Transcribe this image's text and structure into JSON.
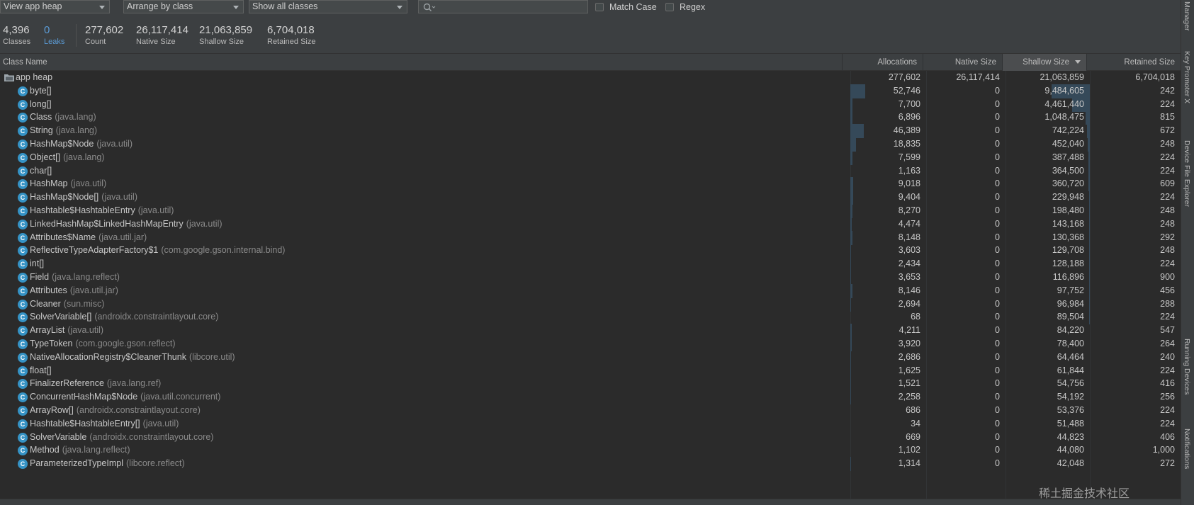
{
  "toolbar": {
    "heap_select": "View app heap",
    "arrange_select": "Arrange by class",
    "filter_select": "Show all classes",
    "search_placeholder": "",
    "match_case_label": "Match Case",
    "regex_label": "Regex"
  },
  "summary": [
    {
      "value": "4,396",
      "label": "Classes"
    },
    {
      "value": "0",
      "label": "Leaks"
    },
    {
      "value": "277,602",
      "label": "Count"
    },
    {
      "value": "26,117,414",
      "label": "Native Size"
    },
    {
      "value": "21,063,859",
      "label": "Shallow Size"
    },
    {
      "value": "6,704,018",
      "label": "Retained Size"
    }
  ],
  "table": {
    "columns": [
      "Class Name",
      "Allocations",
      "Native Size",
      "Shallow Size",
      "Retained Size"
    ],
    "sorted_column": "Shallow Size",
    "root": {
      "name": "app heap",
      "allocations": "277,602",
      "native": "26,117,414",
      "shallow": "21,063,859",
      "retained": "6,704,018"
    },
    "rows": [
      {
        "name": "byte[]",
        "pkg": "",
        "allocations": "52,746",
        "native": "0",
        "shallow": "9,484,605",
        "retained": "242"
      },
      {
        "name": "long[]",
        "pkg": "",
        "allocations": "7,700",
        "native": "0",
        "shallow": "4,461,440",
        "retained": "224"
      },
      {
        "name": "Class",
        "pkg": "(java.lang)",
        "allocations": "6,896",
        "native": "0",
        "shallow": "1,048,475",
        "retained": "815"
      },
      {
        "name": "String",
        "pkg": "(java.lang)",
        "allocations": "46,389",
        "native": "0",
        "shallow": "742,224",
        "retained": "672"
      },
      {
        "name": "HashMap$Node",
        "pkg": "(java.util)",
        "allocations": "18,835",
        "native": "0",
        "shallow": "452,040",
        "retained": "248"
      },
      {
        "name": "Object[]",
        "pkg": "(java.lang)",
        "allocations": "7,599",
        "native": "0",
        "shallow": "387,488",
        "retained": "224"
      },
      {
        "name": "char[]",
        "pkg": "",
        "allocations": "1,163",
        "native": "0",
        "shallow": "364,500",
        "retained": "224"
      },
      {
        "name": "HashMap",
        "pkg": "(java.util)",
        "allocations": "9,018",
        "native": "0",
        "shallow": "360,720",
        "retained": "609"
      },
      {
        "name": "HashMap$Node[]",
        "pkg": "(java.util)",
        "allocations": "9,404",
        "native": "0",
        "shallow": "229,948",
        "retained": "224"
      },
      {
        "name": "Hashtable$HashtableEntry",
        "pkg": "(java.util)",
        "allocations": "8,270",
        "native": "0",
        "shallow": "198,480",
        "retained": "248"
      },
      {
        "name": "LinkedHashMap$LinkedHashMapEntry",
        "pkg": "(java.util)",
        "allocations": "4,474",
        "native": "0",
        "shallow": "143,168",
        "retained": "248"
      },
      {
        "name": "Attributes$Name",
        "pkg": "(java.util.jar)",
        "allocations": "8,148",
        "native": "0",
        "shallow": "130,368",
        "retained": "292"
      },
      {
        "name": "ReflectiveTypeAdapterFactory$1",
        "pkg": "(com.google.gson.internal.bind)",
        "allocations": "3,603",
        "native": "0",
        "shallow": "129,708",
        "retained": "248"
      },
      {
        "name": "int[]",
        "pkg": "",
        "allocations": "2,434",
        "native": "0",
        "shallow": "128,188",
        "retained": "224"
      },
      {
        "name": "Field",
        "pkg": "(java.lang.reflect)",
        "allocations": "3,653",
        "native": "0",
        "shallow": "116,896",
        "retained": "900"
      },
      {
        "name": "Attributes",
        "pkg": "(java.util.jar)",
        "allocations": "8,146",
        "native": "0",
        "shallow": "97,752",
        "retained": "456"
      },
      {
        "name": "Cleaner",
        "pkg": "(sun.misc)",
        "allocations": "2,694",
        "native": "0",
        "shallow": "96,984",
        "retained": "288"
      },
      {
        "name": "SolverVariable[]",
        "pkg": "(androidx.constraintlayout.core)",
        "allocations": "68",
        "native": "0",
        "shallow": "89,504",
        "retained": "224"
      },
      {
        "name": "ArrayList",
        "pkg": "(java.util)",
        "allocations": "4,211",
        "native": "0",
        "shallow": "84,220",
        "retained": "547"
      },
      {
        "name": "TypeToken",
        "pkg": "(com.google.gson.reflect)",
        "allocations": "3,920",
        "native": "0",
        "shallow": "78,400",
        "retained": "264"
      },
      {
        "name": "NativeAllocationRegistry$CleanerThunk",
        "pkg": "(libcore.util)",
        "allocations": "2,686",
        "native": "0",
        "shallow": "64,464",
        "retained": "240"
      },
      {
        "name": "float[]",
        "pkg": "",
        "allocations": "1,625",
        "native": "0",
        "shallow": "61,844",
        "retained": "224"
      },
      {
        "name": "FinalizerReference",
        "pkg": "(java.lang.ref)",
        "allocations": "1,521",
        "native": "0",
        "shallow": "54,756",
        "retained": "416"
      },
      {
        "name": "ConcurrentHashMap$Node",
        "pkg": "(java.util.concurrent)",
        "allocations": "2,258",
        "native": "0",
        "shallow": "54,192",
        "retained": "256"
      },
      {
        "name": "ArrayRow[]",
        "pkg": "(androidx.constraintlayout.core)",
        "allocations": "686",
        "native": "0",
        "shallow": "53,376",
        "retained": "224"
      },
      {
        "name": "Hashtable$HashtableEntry[]",
        "pkg": "(java.util)",
        "allocations": "34",
        "native": "0",
        "shallow": "51,488",
        "retained": "224"
      },
      {
        "name": "SolverVariable",
        "pkg": "(androidx.constraintlayout.core)",
        "allocations": "669",
        "native": "0",
        "shallow": "44,823",
        "retained": "406"
      },
      {
        "name": "Method",
        "pkg": "(java.lang.reflect)",
        "allocations": "1,102",
        "native": "0",
        "shallow": "44,080",
        "retained": "1,000"
      },
      {
        "name": "ParameterizedTypeImpl",
        "pkg": "(libcore.reflect)",
        "allocations": "1,314",
        "native": "0",
        "shallow": "42,048",
        "retained": "272"
      }
    ]
  },
  "side_panel": {
    "tools": [
      "Manager",
      "Key Promoter X",
      "Device File Explorer",
      "Running Devices",
      "Notifications"
    ]
  },
  "watermark": "稀土掘金技术社区",
  "colors": {
    "accent": "#5b9bd5",
    "class_icon": "#3592c4",
    "bar": "#354959"
  }
}
